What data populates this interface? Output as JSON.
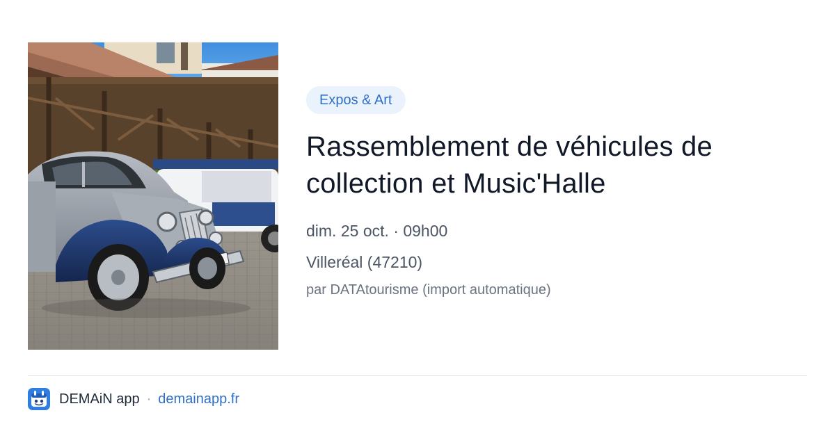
{
  "event": {
    "category": "Expos & Art",
    "title": "Rassemblement de véhicules de collection et Music'Halle",
    "datetime": "dim. 25 oct. · 09h00",
    "location": "Villeréal (47210)",
    "organizer": "par DATAtourisme (import automatique)"
  },
  "footer": {
    "app_name": "DEMAiN app",
    "separator": "·",
    "site": "demainapp.fr"
  },
  "colors": {
    "accent": "#2f6fc8",
    "badge_bg": "#eaf2fc",
    "title": "#111827",
    "meta": "#4b5563"
  }
}
